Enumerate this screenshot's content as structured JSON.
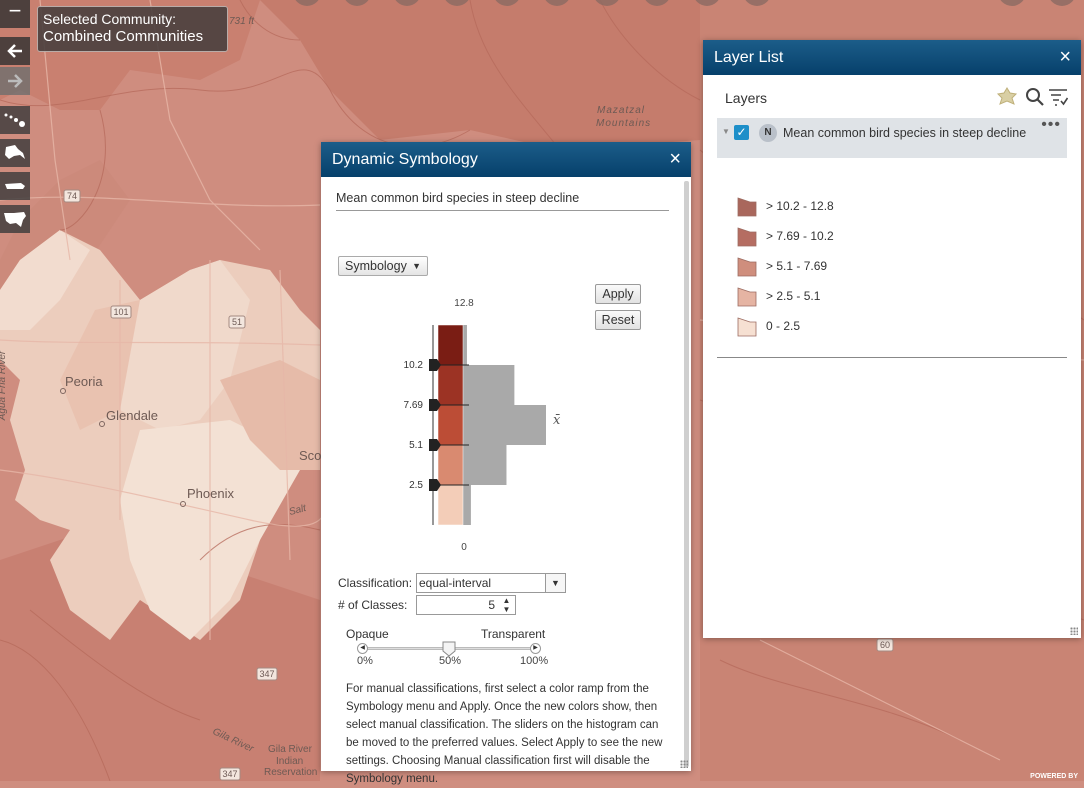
{
  "map": {
    "labels": {
      "peoria": "Peoria",
      "glendale": "Glendale",
      "phoenix": "Phoenix",
      "scot": "Scot",
      "salt": "Salt",
      "mazatzal": "Mazatzal",
      "mountains": "Mountains",
      "gila_river": "Gila River",
      "gila_river_res_1": "Gila River",
      "gila_river_res_2": "Indian",
      "gila_river_res_3": "Reservation",
      "agua_fria": "Agua Fria River",
      "elev": "731 ft"
    },
    "shields": [
      "74",
      "101",
      "51",
      "347",
      "347",
      "60"
    ]
  },
  "controls": {
    "zoom_out": "−",
    "back": "🡐",
    "forward": "🡒",
    "region_icons": [
      "hawaii-icon",
      "alaska-icon",
      "puerto-rico-icon",
      "conus-icon"
    ]
  },
  "community": {
    "label": "Selected Community:",
    "value": "Combined Communities"
  },
  "dynamic_symbology": {
    "title": "Dynamic Symbology",
    "close": "×",
    "layer_title": "Mean common bird species in steep decline",
    "symbology_menu": "Symbology",
    "apply": "Apply",
    "reset": "Reset",
    "histogram": {
      "max_label": "12.8",
      "min_label": "0",
      "mean_symbol": "x̄",
      "breaks": [
        "10.2",
        "7.69",
        "5.1",
        "2.5"
      ],
      "class_colors": [
        "#7a1d14",
        "#9c3324",
        "#bc4d36",
        "#d98a70",
        "#f3cdb8"
      ],
      "bar_values": [
        1,
        13,
        21,
        11,
        2
      ]
    },
    "classification_label": "Classification:",
    "classification_value": "equal-interval",
    "classes_label": "# of Classes:",
    "classes_value": "5",
    "opaque_label": "Opaque",
    "transparent_label": "Transparent",
    "transparency_value": 50,
    "tick_0": "0%",
    "tick_50": "50%",
    "tick_100": "100%",
    "help_text": "For manual classifications, first select a color ramp from the Symbology menu and Apply. Once the new colors show, then select manual classification. The sliders on the histogram can be moved to the preferred values. Select Apply to see the new settings. Choosing Manual classification first will disable the Symbology menu."
  },
  "layer_list": {
    "title": "Layer List",
    "close": "×",
    "heading": "Layers",
    "tools": [
      "map-symbol-icon",
      "search-icon",
      "filter-list-icon"
    ],
    "layer": {
      "badge": "N",
      "name": "Mean common bird species in steep decline",
      "more": "•••",
      "checked": true
    },
    "legend": [
      {
        "label": "> 10.2 - 12.8",
        "color": "#a9675c"
      },
      {
        "label": "> 7.69 - 10.2",
        "color": "#b56d62"
      },
      {
        "label": "> 5.1 - 7.69",
        "color": "#cf8e7d"
      },
      {
        "label": "> 2.5 - 5.1",
        "color": "#e5b4a3"
      },
      {
        "label": "0 - 2.5",
        "color": "#f6e0d2"
      }
    ]
  },
  "footer": {
    "powered_by": "POWERED BY"
  }
}
